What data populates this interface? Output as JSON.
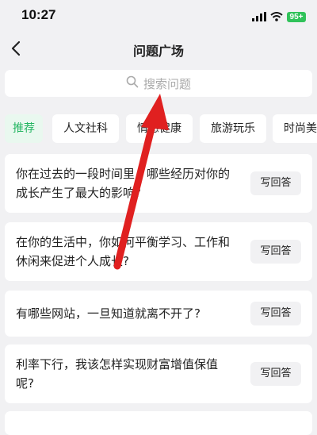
{
  "status_bar": {
    "time": "10:27",
    "battery": "95+"
  },
  "header": {
    "title": "问题广场"
  },
  "search": {
    "placeholder": "搜索问题"
  },
  "tabs": [
    {
      "label": "推荐",
      "active": true
    },
    {
      "label": "人文社科",
      "active": false
    },
    {
      "label": "情感健康",
      "active": false
    },
    {
      "label": "旅游玩乐",
      "active": false
    },
    {
      "label": "时尚美妆",
      "active": false
    }
  ],
  "questions": [
    {
      "text": "你在过去的一段时间里，哪些经历对你的成长产生了最大的影响?",
      "action": "写回答"
    },
    {
      "text": "在你的生活中，你如何平衡学习、工作和休闲来促进个人成长?",
      "action": "写回答"
    },
    {
      "text": "有哪些网站，一旦知道就离不开了?",
      "action": "写回答"
    },
    {
      "text": "利率下行，我该怎样实现财富增值保值呢?",
      "action": "写回答"
    }
  ],
  "colors": {
    "accent": "#23b561",
    "annotation_arrow": "#e02020",
    "background": "#f1f1f3"
  },
  "icons": [
    "signal-icon",
    "wifi-icon",
    "battery-icon",
    "back-chevron-icon",
    "search-icon"
  ]
}
